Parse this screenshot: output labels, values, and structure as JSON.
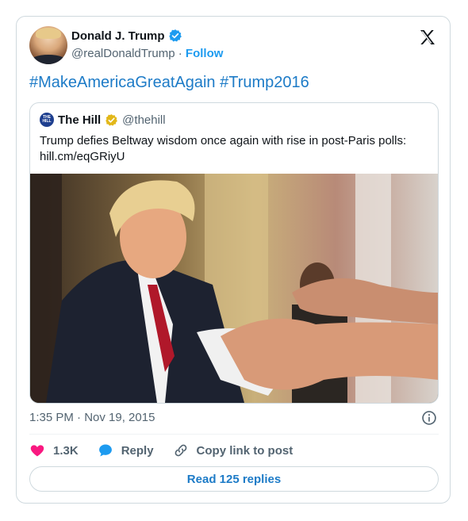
{
  "author": {
    "name": "Donald J. Trump",
    "handle": "@realDonaldTrump",
    "separator": "·",
    "follow_label": "Follow"
  },
  "tweet_text": "#MakeAmericaGreatAgain #Trump2016",
  "quoted": {
    "logo_text": "THE HILL",
    "name": "The Hill",
    "handle": "@thehill",
    "text_line1": "Trump defies Beltway wisdom once again with rise in post-Paris polls:",
    "text_line2": "hill.cm/eqGRiyU"
  },
  "timestamp": "1:35 PM · Nov 19, 2015",
  "actions": {
    "like_count": "1.3K",
    "reply_label": "Reply",
    "copy_label": "Copy link to post"
  },
  "read_replies_label": "Read 125 replies",
  "colors": {
    "accent": "#1d9bf0",
    "link": "#1d7bc7",
    "like": "#f91880",
    "hill_verified": "#e2b719"
  }
}
